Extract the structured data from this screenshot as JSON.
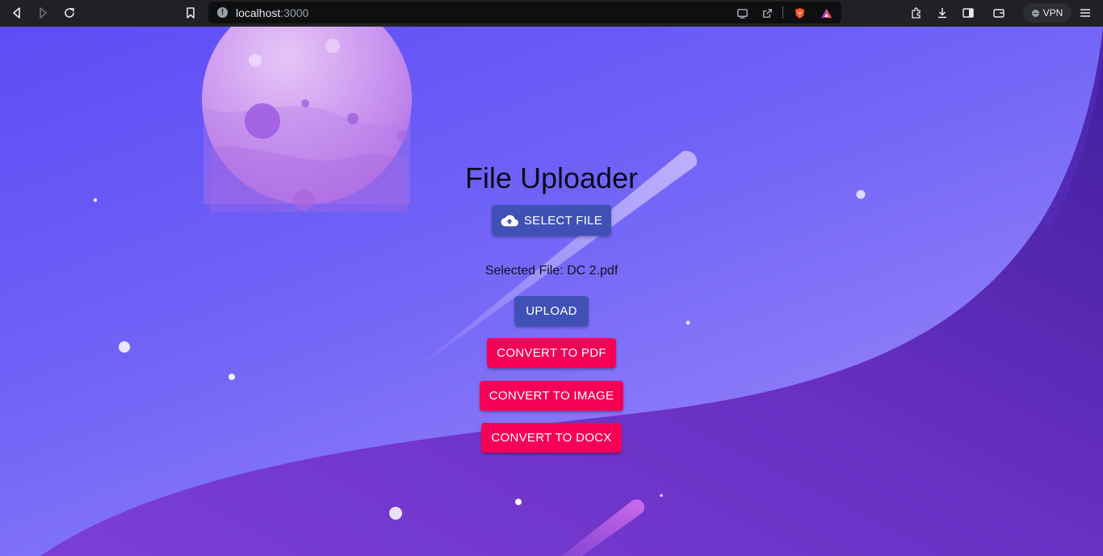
{
  "browser": {
    "url_host": "localhost",
    "url_port": ":3000",
    "vpn_label": "VPN"
  },
  "colors": {
    "primary_button": "#3f51b5",
    "secondary_button": "#f50057",
    "background_top": "#5e4cf5",
    "background_wave": "#6a2fc0"
  },
  "page": {
    "title": "File Uploader",
    "select_file_label": "SELECT FILE",
    "selected_file_text": "Selected File: DC 2.pdf",
    "upload_label": "UPLOAD",
    "convert_pdf_label": "CONVERT TO PDF",
    "convert_image_label": "CONVERT TO IMAGE",
    "convert_docx_label": "CONVERT TO DOCX"
  }
}
